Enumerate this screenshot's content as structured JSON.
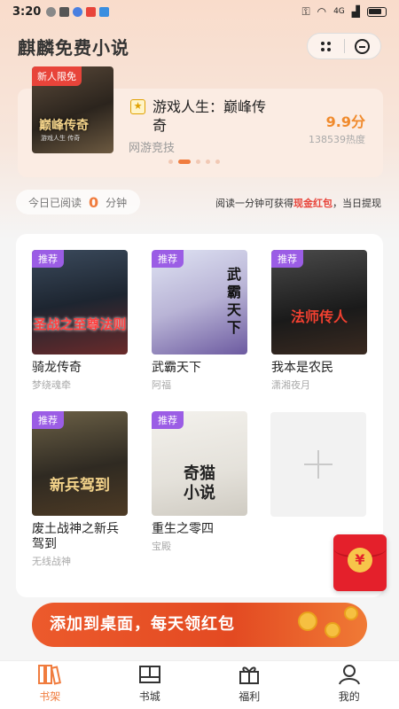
{
  "status_bar": {
    "time": "3:20",
    "signal": "4G"
  },
  "header": {
    "title": "麒麟免费小说"
  },
  "banner": {
    "badge": "新人限免",
    "cover_title": "巅峰传奇",
    "cover_sub": "游戏人生 传奇",
    "title": "游戏人生：巅峰传奇",
    "genre": "网游竞技",
    "score": "9.9分",
    "heat": "138539热度"
  },
  "reading": {
    "prefix": "今日已阅读",
    "minutes": "0",
    "suffix": "分钟"
  },
  "tip": {
    "part1": "阅读一分钟可获得",
    "highlight": "现金红包",
    "part2": "，当日提现"
  },
  "shelf": {
    "badge": "推荐",
    "books": [
      {
        "title": "骑龙传奇",
        "author": "梦绕魂牵",
        "cover_text": "圣战之至尊法则"
      },
      {
        "title": "武霸天下",
        "author": "阿福",
        "cover_text": "武霸天下"
      },
      {
        "title": "我本是农民",
        "author": "潇湘夜月",
        "cover_text": "法师传人"
      },
      {
        "title": "废土战神之新兵驾到",
        "author": "无线战神",
        "cover_text": "新兵驾到"
      },
      {
        "title": "重生之零四",
        "author": "宝殿",
        "cover_text": "奇猫小说"
      }
    ]
  },
  "redpacket": {
    "symbol": "¥"
  },
  "promo": {
    "text": "添加到桌面，每天领红包"
  },
  "tabs": [
    {
      "label": "书架",
      "icon": "bookshelf-icon",
      "active": true
    },
    {
      "label": "书城",
      "icon": "bookstore-icon",
      "active": false
    },
    {
      "label": "福利",
      "icon": "gift-icon",
      "active": false
    },
    {
      "label": "我的",
      "icon": "profile-icon",
      "active": false
    }
  ],
  "colors": {
    "accent": "#f07c3e",
    "tag_red": "#e8443a",
    "recommend_purple": "#9b5de5"
  }
}
